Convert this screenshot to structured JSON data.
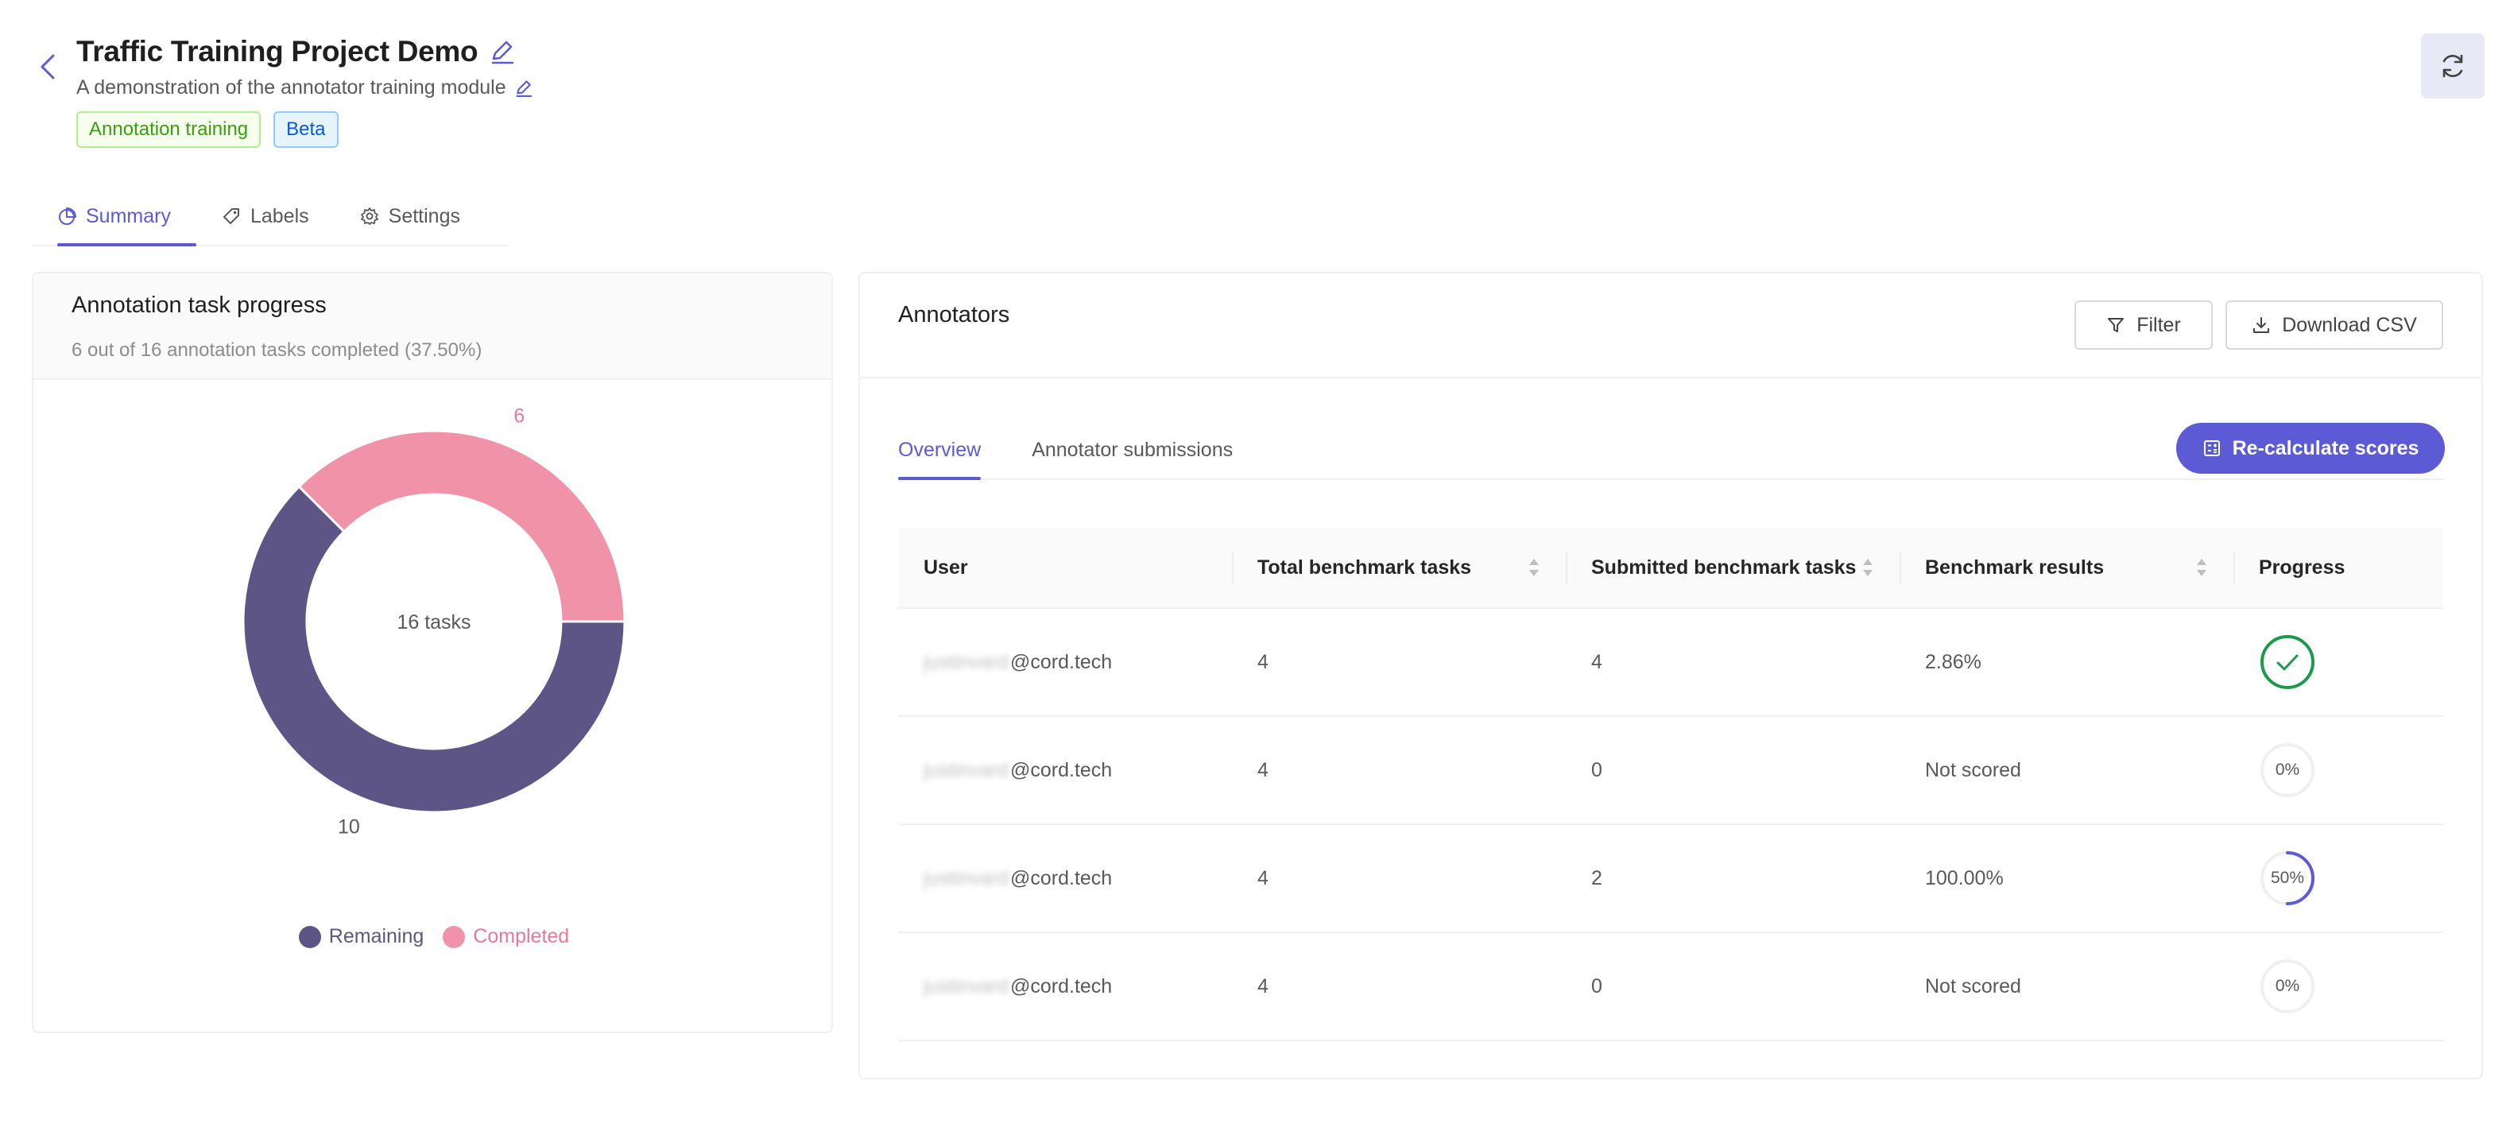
{
  "header": {
    "title": "Traffic Training Project Demo",
    "subtitle": "A demonstration of the annotator training module",
    "tags": [
      "Annotation training",
      "Beta"
    ]
  },
  "icons": {
    "back": "chevron-left-icon",
    "edit": "pencil-icon",
    "refresh": "sync-icon",
    "summary": "pie-chart-icon",
    "labels": "tag-icon",
    "settings": "gear-icon",
    "filter": "funnel-icon",
    "download": "download-icon",
    "calculator": "calculator-icon",
    "sort": "sort-icon",
    "check": "check-icon"
  },
  "tabs": [
    {
      "label": "Summary",
      "active": true
    },
    {
      "label": "Labels",
      "active": false
    },
    {
      "label": "Settings",
      "active": false
    }
  ],
  "progress_card": {
    "title": "Annotation task progress",
    "subtitle": "6 out of 16 annotation tasks completed (37.50%)",
    "center_label": "16 tasks"
  },
  "chart_data": {
    "type": "pie",
    "categories": [
      "Remaining",
      "Completed"
    ],
    "values": [
      10,
      6
    ],
    "colors": [
      "#5c5585",
      "#f092a8"
    ],
    "legend": "bottom"
  },
  "annotators_card": {
    "title": "Annotators",
    "filter_label": "Filter",
    "download_label": "Download CSV",
    "subtabs": [
      {
        "label": "Overview",
        "active": true
      },
      {
        "label": "Annotator submissions",
        "active": false
      }
    ],
    "recalc_label": "Re-calculate scores",
    "columns": [
      "User",
      "Total benchmark tasks",
      "Submitted benchmark tasks",
      "Benchmark results",
      "Progress"
    ],
    "rows": [
      {
        "user_hidden": "justinvard",
        "user_domain": "@cord.tech",
        "total": "4",
        "submitted": "4",
        "result": "2.86%",
        "progress": 100,
        "progress_label": ""
      },
      {
        "user_hidden": "justinvard",
        "user_domain": "@cord.tech",
        "total": "4",
        "submitted": "0",
        "result": "Not scored",
        "progress": 0,
        "progress_label": "0%"
      },
      {
        "user_hidden": "justinvard",
        "user_domain": "@cord.tech",
        "total": "4",
        "submitted": "2",
        "result": "100.00%",
        "progress": 50,
        "progress_label": "50%"
      },
      {
        "user_hidden": "justinvard",
        "user_domain": "@cord.tech",
        "total": "4",
        "submitted": "0",
        "result": "Not scored",
        "progress": 0,
        "progress_label": "0%"
      }
    ]
  },
  "colors": {
    "primary": "#5c5ad4",
    "success": "#1a9a4a",
    "remaining": "#5c5585",
    "completed": "#f092a8"
  }
}
